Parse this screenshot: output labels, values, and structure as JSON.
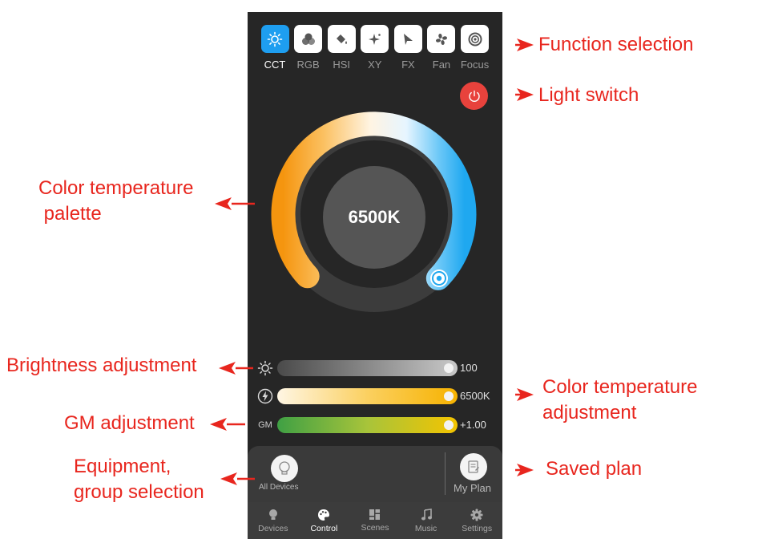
{
  "tabs": [
    {
      "label": "CCT",
      "icon": "sun-icon",
      "active": true
    },
    {
      "label": "RGB",
      "icon": "rgb-circles-icon",
      "active": false
    },
    {
      "label": "HSI",
      "icon": "paint-bucket-icon",
      "active": false
    },
    {
      "label": "XY",
      "icon": "sparkle-icon",
      "active": false
    },
    {
      "label": "FX",
      "icon": "effects-icon",
      "active": false
    },
    {
      "label": "Fan",
      "icon": "fan-icon",
      "active": false
    },
    {
      "label": "Focus",
      "icon": "focus-icon",
      "active": false
    }
  ],
  "wheel": {
    "value": "6500K"
  },
  "sliders": {
    "brightness": {
      "value": "100",
      "level": 1.0
    },
    "cct": {
      "value": "6500K",
      "level": 1.0
    },
    "gm": {
      "label": "GM",
      "value": "+1.00",
      "level": 1.0
    }
  },
  "panel": {
    "all_devices": "All Devices",
    "my_plan": "My Plan"
  },
  "nav": [
    {
      "label": "Devices",
      "icon": "bulb-icon",
      "active": false
    },
    {
      "label": "Control",
      "icon": "palette-icon",
      "active": true
    },
    {
      "label": "Scenes",
      "icon": "grid-icon",
      "active": false
    },
    {
      "label": "Music",
      "icon": "music-note-icon",
      "active": false
    },
    {
      "label": "Settings",
      "icon": "gear-icon",
      "active": false
    }
  ],
  "annotations": {
    "function_selection": "Function selection",
    "light_switch": "Light switch",
    "palette_line1": "Color temperature",
    "palette_line2": " palette",
    "brightness": "Brightness adjustment",
    "cct_line1": "Color temperature",
    "cct_line2": "adjustment",
    "gm": "GM adjustment",
    "equip_line1": "Equipment,",
    "equip_line2": "group selection",
    "saved_plan": "Saved plan"
  },
  "colors": {
    "accent": "#1e9ef0",
    "power": "#e8423c",
    "annotation": "#e8261e",
    "warm": "#f5950f",
    "cool": "#1fa8f0"
  }
}
